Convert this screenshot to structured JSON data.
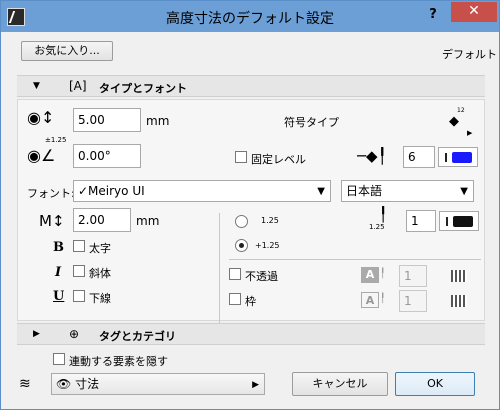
{
  "window": {
    "title": "高度寸法のデフォルト設定",
    "help": "?",
    "close": "✕"
  },
  "favorites": {
    "button": "お気に入り...",
    "preset": "デフォルト"
  },
  "type_font": {
    "section_label": "タイプとフォント",
    "marker_size": "5.00",
    "marker_unit": "mm",
    "symbol_type_label": "符号タイプ",
    "angle": "0.00°",
    "fixed_level_label": "固定レベル",
    "pen_number": "6",
    "font_label": "フォント:",
    "font_value": "✓Meiryo UI",
    "language_value": "日本語",
    "text_size": "2.00",
    "text_unit": "mm",
    "bold_label": "太字",
    "italic_label": "斜体",
    "underline_label": "下線",
    "radio1_label": "1.25",
    "radio2_label": "+1.25",
    "text_pen_number": "1",
    "opaque_label": "不透過",
    "opaque_pen": "1",
    "frame_label": "枠",
    "frame_pen": "1",
    "icon_marker_level_sub": "±1.25",
    "icon_symbol_sup": "12",
    "icon_pen_sub": "1.25"
  },
  "tags": {
    "section_label": "タグとカテゴリ"
  },
  "footer": {
    "hide_connected_label": "連動する要素を隠す",
    "layer_value": "寸法",
    "cancel": "キャンセル",
    "ok": "OK"
  },
  "colors": {
    "pen_blue": "#1a1aff",
    "pen_black": "#111111",
    "title_bar": "#6b9fd6"
  }
}
